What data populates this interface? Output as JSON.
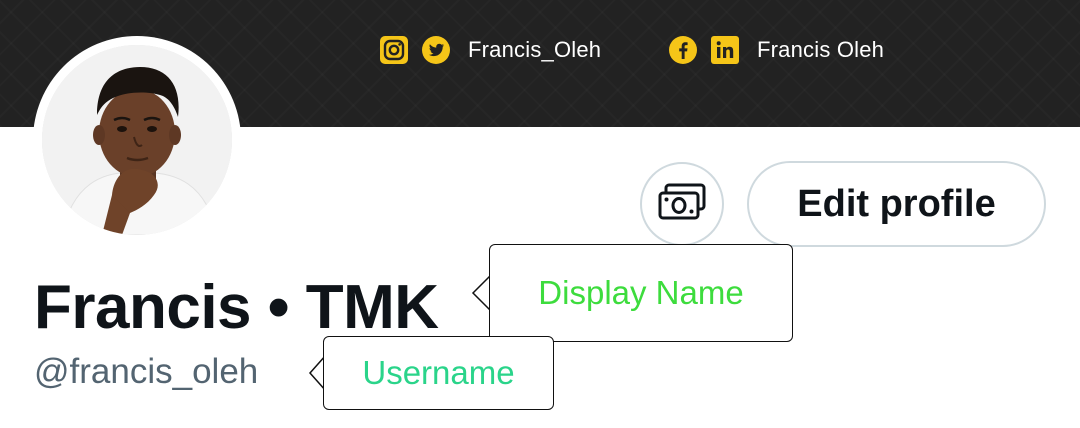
{
  "banner": {
    "twitter_handle": "Francis_Oleh",
    "facebook_name": "Francis Oleh",
    "icons": [
      "instagram-icon",
      "twitter-icon",
      "facebook-icon",
      "linkedin-icon"
    ],
    "accent_color": "#f5c518"
  },
  "profile": {
    "display_name": "Francis • TMK",
    "username": "@francis_oleh",
    "edit_label": "Edit profile"
  },
  "annotations": {
    "display_name_label": "Display Name",
    "display_name_color": "#3ddc3d",
    "username_label": "Username",
    "username_color": "#2ad48a"
  }
}
